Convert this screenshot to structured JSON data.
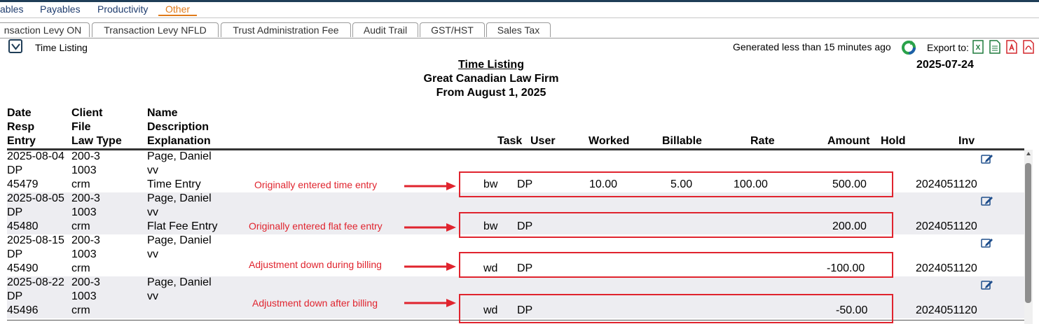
{
  "menu": {
    "items": [
      {
        "label": "ables"
      },
      {
        "label": "Payables"
      },
      {
        "label": "Productivity"
      },
      {
        "label": "Other"
      }
    ]
  },
  "tabs": [
    {
      "label": "nsaction Levy ON"
    },
    {
      "label": "Transaction Levy NFLD"
    },
    {
      "label": "Trust Administration Fee"
    },
    {
      "label": "Audit Trail"
    },
    {
      "label": "GST/HST"
    },
    {
      "label": "Sales Tax"
    }
  ],
  "toolbar": {
    "section_title": "Time Listing",
    "generated_text": "Generated less than 15 minutes ago",
    "export_label": "Export to:",
    "export_icons": [
      "excel-icon",
      "csv-icon",
      "pdf-icon",
      "pdf-alt-icon"
    ]
  },
  "report": {
    "title": "Time Listing",
    "firm": "Great Canadian Law Firm",
    "period": "From August 1, 2025",
    "date": "2025-07-24",
    "headers": {
      "date": "Date",
      "resp": "Resp",
      "entry": "Entry",
      "client": "Client",
      "file": "File",
      "law_type": "Law Type",
      "name": "Name",
      "description": "Description",
      "explanation": "Explanation",
      "task": "Task",
      "user": "User",
      "worked": "Worked",
      "billable": "Billable",
      "rate": "Rate",
      "amount": "Amount",
      "hold": "Hold",
      "inv": "Inv"
    },
    "rows": [
      {
        "date": "2025-08-04",
        "resp": "DP",
        "entry": "45479",
        "client": "200-3",
        "file": "1003",
        "law_type": "crm",
        "name": "Page, Daniel",
        "description": "vv",
        "explanation": "Time Entry",
        "task": "bw",
        "user": "DP",
        "worked": "10.00",
        "billable": "5.00",
        "rate": "100.00",
        "amount": "500.00",
        "inv": "2024051120"
      },
      {
        "date": "2025-08-05",
        "resp": "DP",
        "entry": "45480",
        "client": "200-3",
        "file": "1003",
        "law_type": "crm",
        "name": "Page, Daniel",
        "description": "vv",
        "explanation": "Flat Fee Entry",
        "task": "bw",
        "user": "DP",
        "worked": "",
        "billable": "",
        "rate": "",
        "amount": "200.00",
        "inv": "2024051120"
      },
      {
        "date": "2025-08-15",
        "resp": "DP",
        "entry": "45490",
        "client": "200-3",
        "file": "1003",
        "law_type": "crm",
        "name": "Page, Daniel",
        "description": "vv",
        "explanation": "",
        "task": "wd",
        "user": "DP",
        "worked": "",
        "billable": "",
        "rate": "",
        "amount": "-100.00",
        "inv": "2024051120"
      },
      {
        "date": "2025-08-22",
        "resp": "DP",
        "entry": "45496",
        "client": "200-3",
        "file": "1003",
        "law_type": "crm",
        "name": "Page, Daniel",
        "description": "vv",
        "explanation": "",
        "task": "wd",
        "user": "DP",
        "worked": "",
        "billable": "",
        "rate": "",
        "amount": "-50.00",
        "inv": "2024051120"
      }
    ]
  },
  "annotations": [
    {
      "text": "Originally entered time entry"
    },
    {
      "text": "Originally entered flat fee entry"
    },
    {
      "text": "Adjustment down during billing"
    },
    {
      "text": "Adjustment down after billing"
    }
  ],
  "colors": {
    "accent_orange": "#e07b1a",
    "annotation_red": "#e0242e",
    "nav_blue": "#1e3c6e",
    "alt_row": "#ededf1"
  }
}
